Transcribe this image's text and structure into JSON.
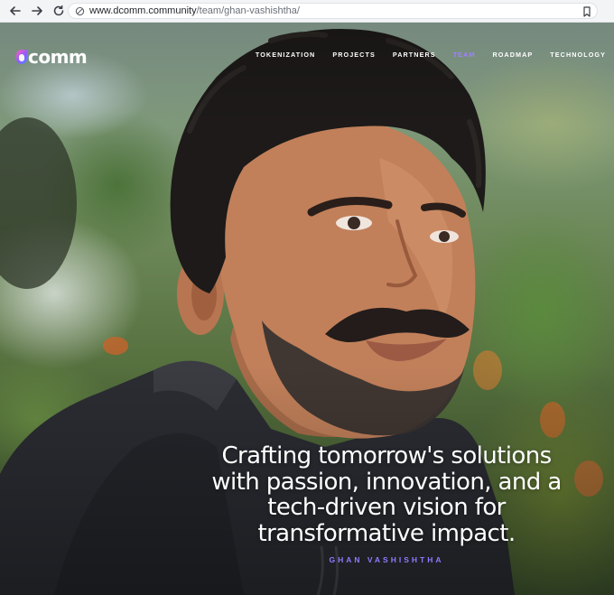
{
  "browser": {
    "url_host": "www.dcomm.community",
    "url_path": "/team/ghan-vashishtha/"
  },
  "icons": {
    "back": "arrow-left-icon",
    "forward": "arrow-right-icon",
    "reload": "reload-icon",
    "site_info": "site-info-icon",
    "bookmark": "bookmark-icon"
  },
  "brand": {
    "logo_text": "comm",
    "accent_color": "#9b83ff"
  },
  "nav": {
    "items": [
      {
        "label": "TOKENIZATION",
        "active": false
      },
      {
        "label": "PROJECTS",
        "active": false
      },
      {
        "label": "PARTNERS",
        "active": false
      },
      {
        "label": "TEAM",
        "active": true
      },
      {
        "label": "ROADMAP",
        "active": false
      },
      {
        "label": "TECHNOLOGY",
        "active": false
      }
    ]
  },
  "hero": {
    "quote": "Crafting tomorrow's solutions with passion, innovation, and a tech-driven vision for transformative impact.",
    "author": "GHAN VASHISHTHA"
  }
}
